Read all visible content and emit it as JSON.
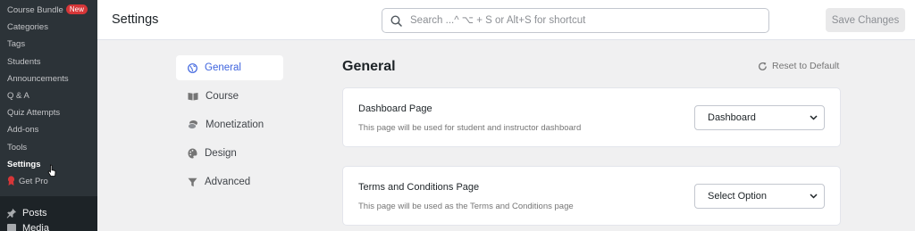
{
  "sidebar": {
    "submenu": [
      {
        "label": "Course Bundle",
        "badge": "New"
      },
      {
        "label": "Categories"
      },
      {
        "label": "Tags"
      },
      {
        "label": "Students"
      },
      {
        "label": "Announcements"
      },
      {
        "label": "Q & A"
      },
      {
        "label": "Quiz Attempts"
      },
      {
        "label": "Add-ons"
      },
      {
        "label": "Tools"
      },
      {
        "label": "Settings",
        "current": true
      },
      {
        "label": "Get Pro",
        "icon": "pro-badge-icon"
      }
    ],
    "top_menu": [
      {
        "label": "Posts",
        "icon": "pin-icon"
      },
      {
        "label": "Media",
        "icon": "media-icon"
      }
    ]
  },
  "header": {
    "title": "Settings",
    "search_placeholder": "Search ...^ ⌥ + S or Alt+S for shortcut",
    "save_label": "Save Changes"
  },
  "nav": {
    "items": [
      {
        "label": "General",
        "icon": "globe-icon",
        "active": true
      },
      {
        "label": "Course",
        "icon": "book-icon"
      },
      {
        "label": "Monetization",
        "icon": "coins-icon"
      },
      {
        "label": "Design",
        "icon": "palette-icon"
      },
      {
        "label": "Advanced",
        "icon": "filter-icon"
      }
    ]
  },
  "main": {
    "title": "General",
    "reset_label": "Reset to Default",
    "fields": [
      {
        "label": "Dashboard Page",
        "description": "This page will be used for student and instructor dashboard",
        "value": "Dashboard"
      },
      {
        "label": "Terms and Conditions Page",
        "description": "This page will be used as the Terms and Conditions page",
        "value": "Select Option"
      }
    ]
  },
  "colors": {
    "accent": "#3e64de",
    "sidebar_bg": "#1d2327",
    "submenu_bg": "#2c3338",
    "badge": "#d63638",
    "page_bg": "#f0f0f1"
  }
}
